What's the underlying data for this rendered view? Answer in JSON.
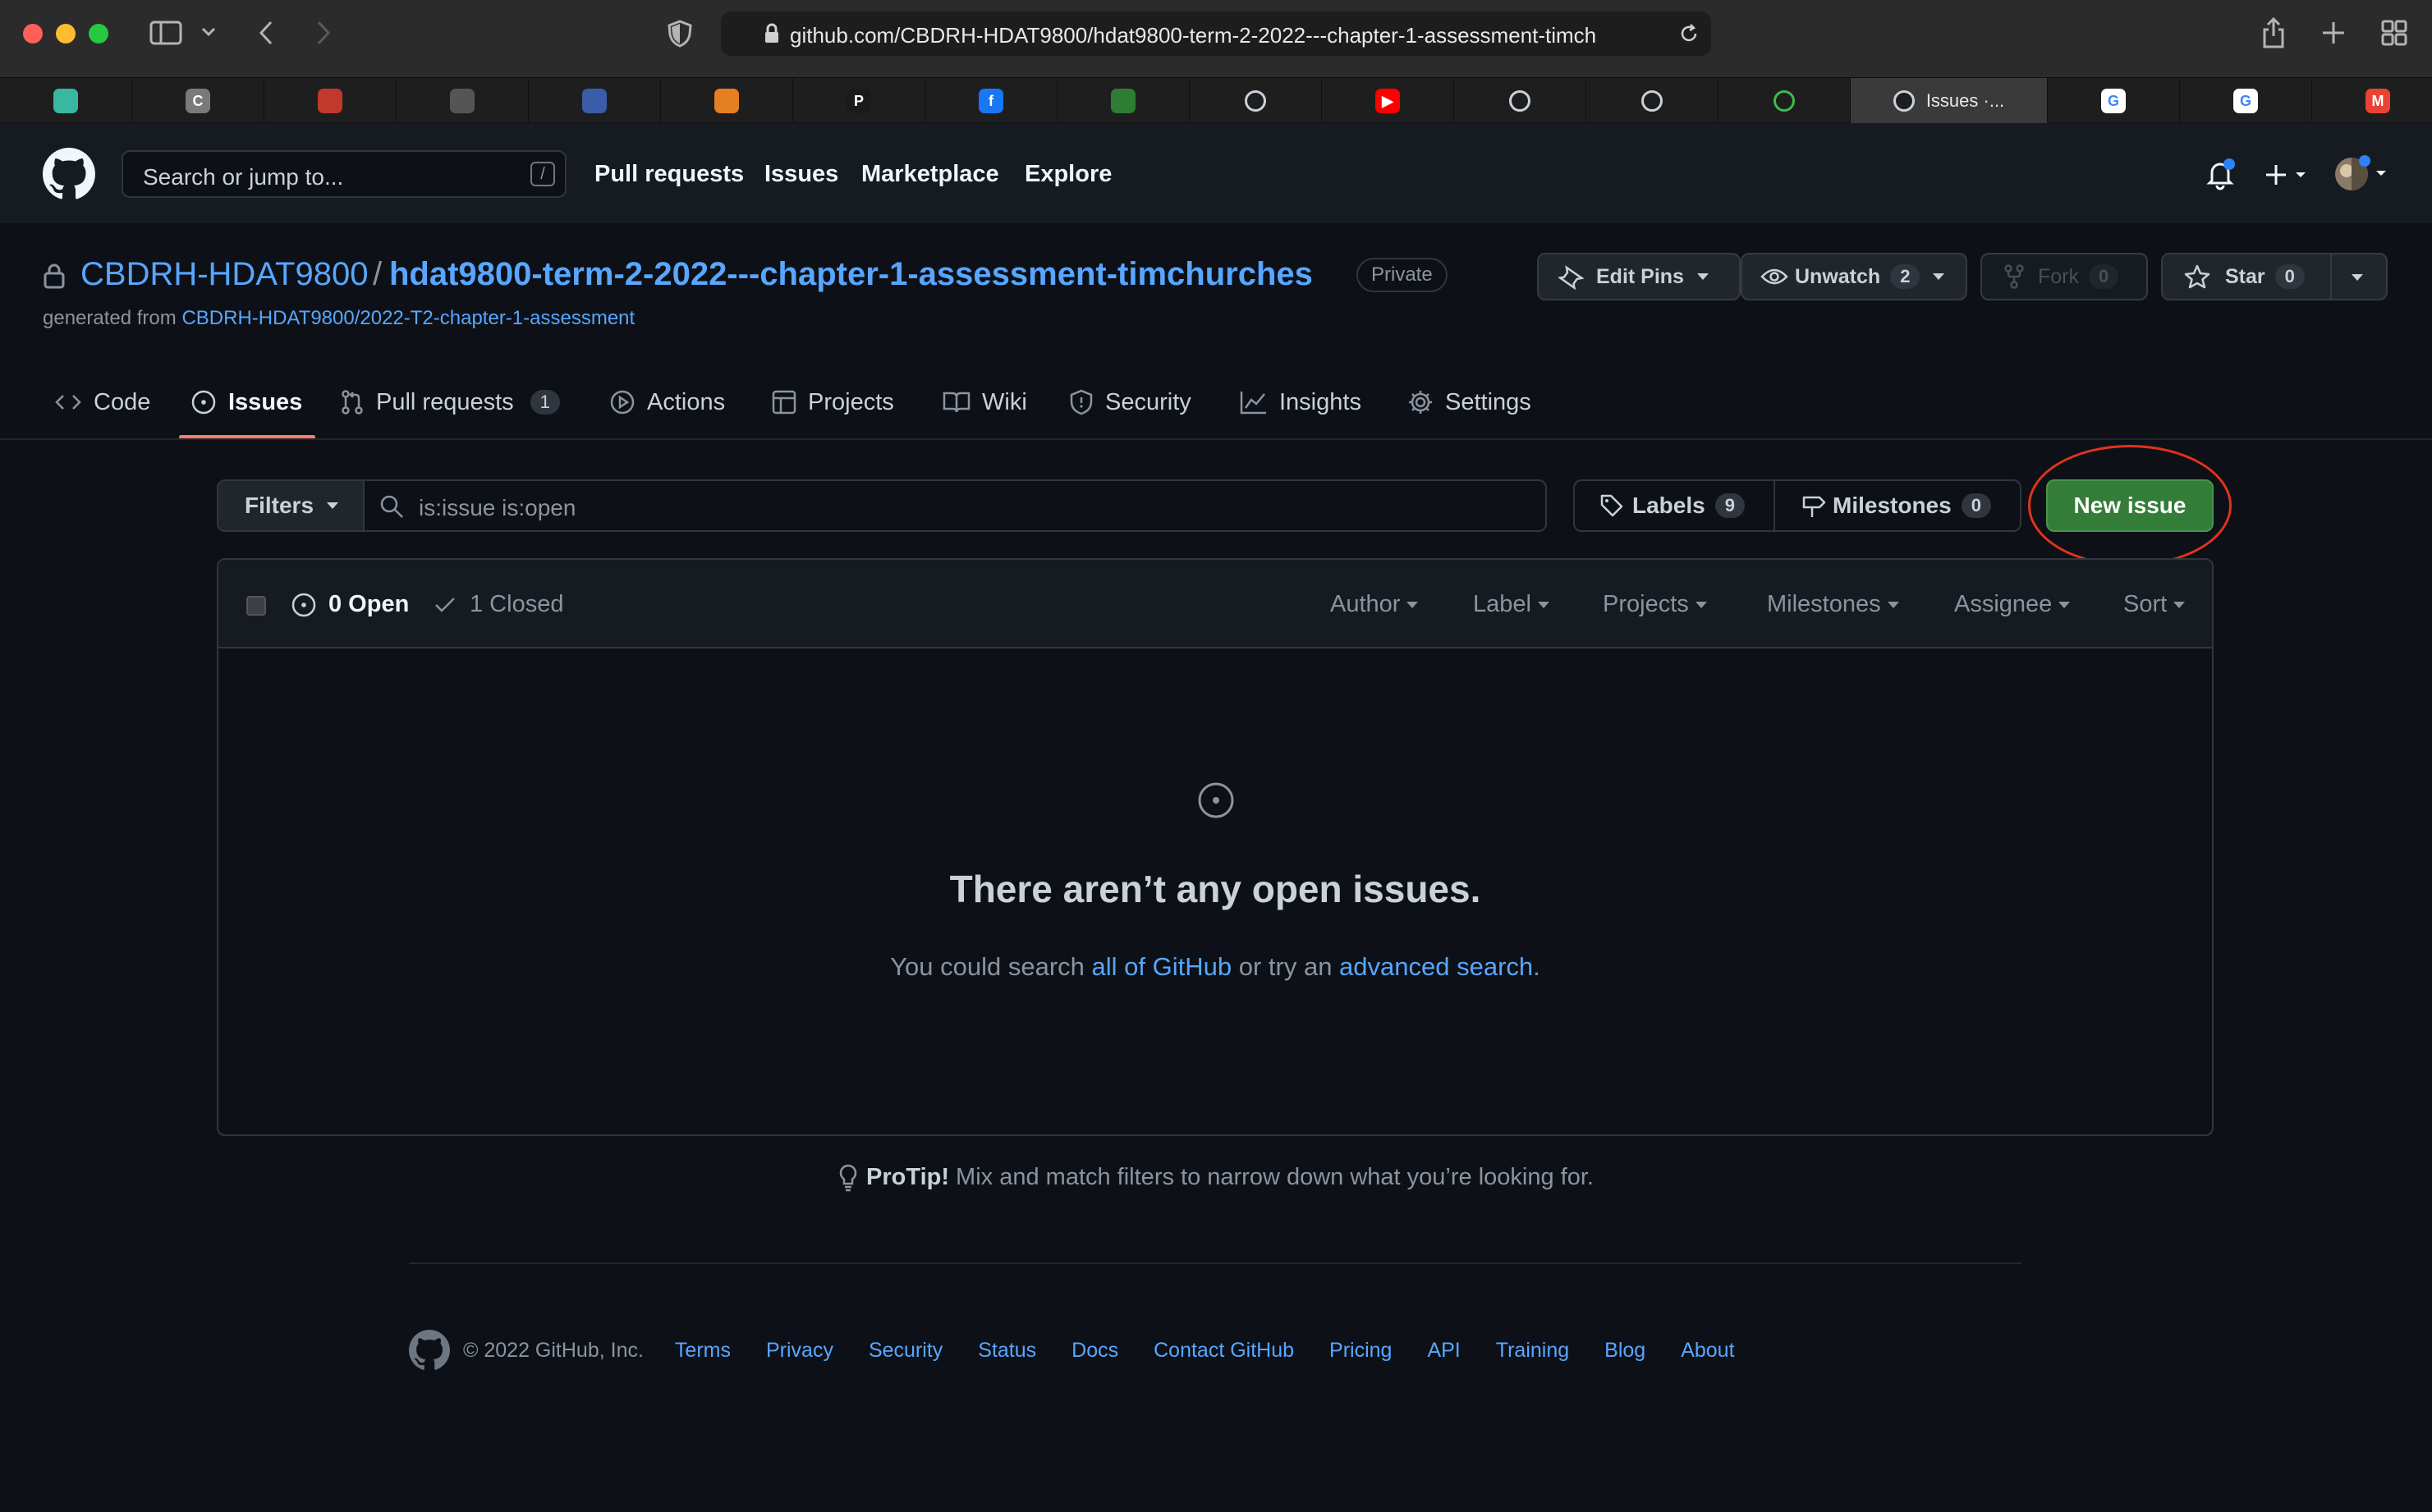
{
  "browser": {
    "url": "github.com/CBDRH-HDAT9800/hdat9800-term-2-2022---chapter-1-assessment-timch",
    "tabs": [
      {
        "icon": "generic-app-icon",
        "color": "#3ab7a0",
        "glyph": ""
      },
      {
        "icon": "c-app-icon",
        "color": "#7a7a7a",
        "glyph": "C"
      },
      {
        "icon": "cube-app-icon",
        "color": "#c0392b",
        "glyph": ""
      },
      {
        "icon": "compass-icon",
        "color": "#555555",
        "glyph": ""
      },
      {
        "icon": "shield-app-icon",
        "color": "#3b5ca8",
        "glyph": ""
      },
      {
        "icon": "colorwheel-icon",
        "color": "#e67e22",
        "glyph": ""
      },
      {
        "icon": "p-app-icon",
        "color": "#1a1a1a",
        "glyph": "P"
      },
      {
        "icon": "facebook-icon",
        "color": "#1877f2",
        "glyph": "f"
      },
      {
        "icon": "grid-app-icon",
        "color": "#2e7d32",
        "glyph": ""
      },
      {
        "icon": "github-icon",
        "color": "#1e1e1e",
        "glyph": ""
      },
      {
        "icon": "youtube-icon",
        "color": "#ff0000",
        "glyph": "▶"
      },
      {
        "icon": "github-icon",
        "color": "#1e1e1e",
        "glyph": ""
      },
      {
        "icon": "github-icon",
        "color": "#1e1e1e",
        "glyph": ""
      },
      {
        "icon": "github-green-icon",
        "color": "#1e1e1e",
        "glyph": ""
      },
      {
        "icon": "github-icon",
        "color": "#1e1e1e",
        "glyph": "",
        "label": "Issues ·...",
        "active": true
      },
      {
        "icon": "google-icon",
        "color": "#ffffff",
        "glyph": "G"
      },
      {
        "icon": "google-icon",
        "color": "#ffffff",
        "glyph": "G"
      },
      {
        "icon": "gmail-icon",
        "color": "#ea4335",
        "glyph": "M"
      }
    ]
  },
  "header": {
    "search_placeholder": "Search or jump to...",
    "search_shortcut": "/",
    "nav": [
      "Pull requests",
      "Issues",
      "Marketplace",
      "Explore"
    ]
  },
  "repo": {
    "owner": "CBDRH-HDAT9800",
    "separator": "/",
    "name": "hdat9800-term-2-2022---chapter-1-assessment-timchurches",
    "visibility": "Private",
    "generated_prefix": "generated from",
    "generated_from": "CBDRH-HDAT9800/2022-T2-chapter-1-assessment",
    "edit_pins": "Edit Pins",
    "unwatch": "Unwatch",
    "watch_count": "2",
    "fork": "Fork",
    "fork_count": "0",
    "star": "Star",
    "star_count": "0"
  },
  "tabs": [
    {
      "label": "Code"
    },
    {
      "label": "Issues",
      "active": true
    },
    {
      "label": "Pull requests",
      "count": "1"
    },
    {
      "label": "Actions"
    },
    {
      "label": "Projects"
    },
    {
      "label": "Wiki"
    },
    {
      "label": "Security"
    },
    {
      "label": "Insights"
    },
    {
      "label": "Settings"
    }
  ],
  "filters": {
    "button": "Filters",
    "query": "is:issue is:open",
    "labels": "Labels",
    "labels_count": "9",
    "milestones": "Milestones",
    "milestones_count": "0",
    "new_issue": "New issue"
  },
  "issues": {
    "open": "0 Open",
    "closed": "1 Closed",
    "dropdowns": [
      "Author",
      "Label",
      "Projects",
      "Milestones",
      "Assignee",
      "Sort"
    ],
    "blank_title": "There aren’t any open issues.",
    "blank_pre": "You could search ",
    "blank_link1": "all of GitHub",
    "blank_mid": " or try an ",
    "blank_link2": "advanced search",
    "blank_post": "."
  },
  "protip": {
    "label": "ProTip!",
    "text": " Mix and match filters to narrow down what you’re looking for."
  },
  "footer": {
    "copyright": "© 2022 GitHub, Inc.",
    "links": [
      "Terms",
      "Privacy",
      "Security",
      "Status",
      "Docs",
      "Contact GitHub",
      "Pricing",
      "API",
      "Training",
      "Blog",
      "About"
    ]
  },
  "colors": {
    "primary_button": "#347d39",
    "accent_link": "#58a6ff",
    "active_tab_underline": "#f78166",
    "annotation_circle": "#e0331f"
  }
}
